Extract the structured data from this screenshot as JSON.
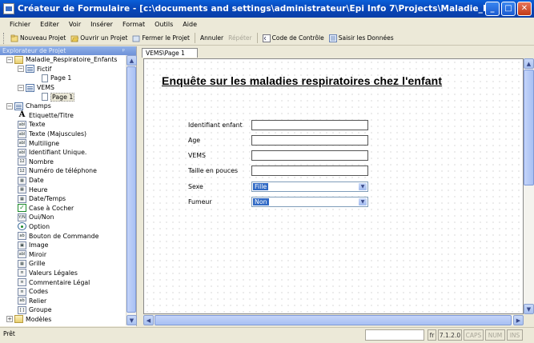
{
  "window": {
    "title": "Créateur de Formulaire - [c:\\documents and settings\\administrateur\\Epi Info 7\\Projects\\Maladie_Respiratoire_Enfants\\Maladie...",
    "min_glyph": "_",
    "max_glyph": "□",
    "close_glyph": "✕"
  },
  "menu": [
    "Fichier",
    "Editer",
    "Voir",
    "Insérer",
    "Format",
    "Outils",
    "Aide"
  ],
  "toolbar": {
    "new_project": "Nouveau Projet",
    "open_project": "Ouvrir un Projet",
    "close_project": "Fermer le Projet",
    "undo": "Annuler",
    "redo": "Répéter",
    "check_code": "Code de Contrôle",
    "enter_data": "Saisir les Données"
  },
  "explorer": {
    "header": "Explorateur de Projet",
    "pin_glyph": "ᵖ",
    "project": "Maladie_Respiratoire_Enfants",
    "views": [
      {
        "name": "Fictif",
        "page": "Page 1"
      },
      {
        "name": "VEMS",
        "page": "Page 1"
      }
    ],
    "fields_group": "Champs",
    "field_types": [
      {
        "label": "Etiquette/Titre",
        "icon": "A"
      },
      {
        "label": "Texte",
        "icon": "abl"
      },
      {
        "label": "Texte (Majuscules)",
        "icon": "abl"
      },
      {
        "label": "Multiligne",
        "icon": "abl"
      },
      {
        "label": "Identifiant Unique.",
        "icon": "abl"
      },
      {
        "label": "Nombre",
        "icon": "12"
      },
      {
        "label": "Numéro de téléphone",
        "icon": "12"
      },
      {
        "label": "Date",
        "icon": "cal"
      },
      {
        "label": "Heure",
        "icon": "cal"
      },
      {
        "label": "Date/Temps",
        "icon": "cal"
      },
      {
        "label": "Case à Cocher",
        "icon": "check"
      },
      {
        "label": "Oui/Non",
        "icon": "yn"
      },
      {
        "label": "Option",
        "icon": "radio"
      },
      {
        "label": "Bouton de Commande",
        "icon": "ab"
      },
      {
        "label": "Image",
        "icon": "img"
      },
      {
        "label": "Miroir",
        "icon": "abl"
      },
      {
        "label": "Grille",
        "icon": "grid"
      },
      {
        "label": "Valeurs Légales",
        "icon": "list"
      },
      {
        "label": "Commentaire Légal",
        "icon": "list"
      },
      {
        "label": "Codes",
        "icon": "list"
      },
      {
        "label": "Relier",
        "icon": "ab"
      },
      {
        "label": "Groupe",
        "icon": "grp"
      },
      {
        "label": "Modèles",
        "icon": "folder"
      }
    ]
  },
  "document": {
    "tab": "VEMS\\Page 1",
    "form_title": "Enquête sur les maladies respiratoires chez l'enfant",
    "fields": [
      {
        "label": "Identifiant enfant",
        "type": "text",
        "value": ""
      },
      {
        "label": "Age",
        "type": "text",
        "value": ""
      },
      {
        "label": "VEMS",
        "type": "text",
        "value": ""
      },
      {
        "label": "Taille en pouces",
        "type": "text",
        "value": ""
      },
      {
        "label": "Sexe",
        "type": "select",
        "value": "Fille"
      },
      {
        "label": "Fumeur",
        "type": "select",
        "value": "Non"
      }
    ]
  },
  "status": {
    "left": "Prêt",
    "fr": "fr",
    "version": "7.1.2.0",
    "caps": "CAPS",
    "num": "NUM",
    "ins": "INS"
  }
}
